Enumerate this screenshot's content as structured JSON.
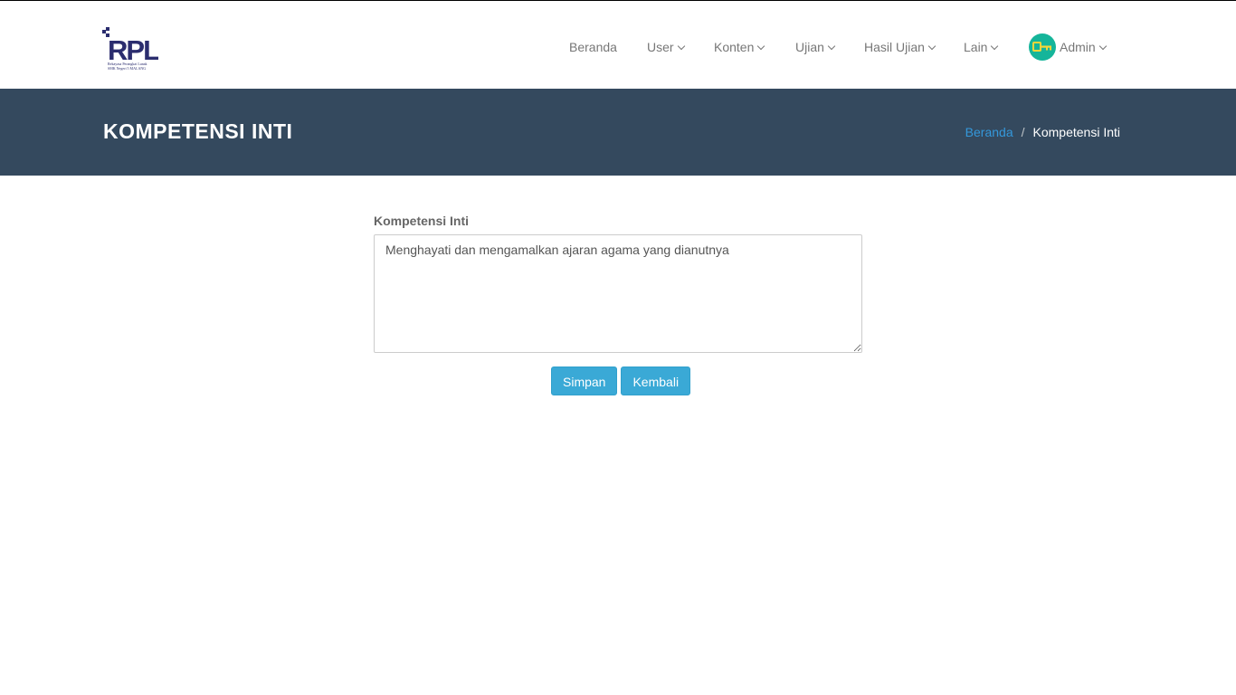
{
  "logo": {
    "mark_text": "RPL",
    "tagline_line1": "Rekayasa Perangkat Lunak",
    "tagline_line2": "SMK Negeri 5 MALANG"
  },
  "nav": {
    "items": [
      {
        "label": "Beranda",
        "dropdown": false
      },
      {
        "label": "User",
        "dropdown": true
      },
      {
        "label": "Konten",
        "dropdown": true
      },
      {
        "label": "Ujian",
        "dropdown": true
      },
      {
        "label": "Hasil Ujian",
        "dropdown": true
      },
      {
        "label": "Lain",
        "dropdown": true
      }
    ],
    "user": {
      "label": "Admin",
      "avatar_icon": "key-icon",
      "avatar_color": "#15b59a"
    }
  },
  "banner": {
    "title": "KOMPETENSI INTI",
    "background": "#34495e",
    "breadcrumb": {
      "home": "Beranda",
      "separator": "/",
      "current": "Kompetensi Inti"
    }
  },
  "form": {
    "label": "Kompetensi Inti",
    "value": "Menghayati dan mengamalkan ajaran agama yang dianutnya",
    "save_label": "Simpan",
    "back_label": "Kembali",
    "button_color": "#3aa9d6"
  }
}
